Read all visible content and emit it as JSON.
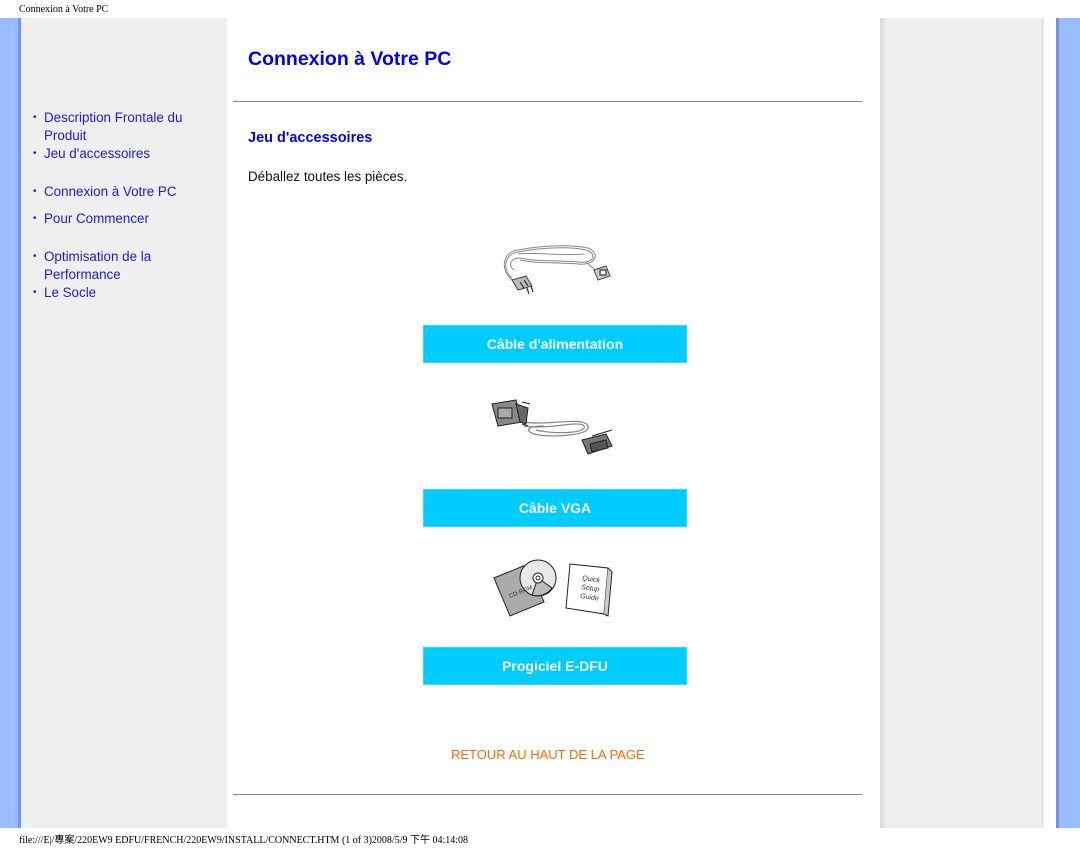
{
  "print_header": "Connexion à Votre PC",
  "print_footer": "file:///E|/專案/220EW9 EDFU/FRENCH/220EW9/INSTALL/CONNECT.HTM (1 of 3)2008/5/9 下午 04:14:08",
  "sidebar": {
    "bullet": "•",
    "items": [
      {
        "label": "Description Frontale du Produit"
      },
      {
        "label": "Jeu d'accessoires"
      },
      {
        "label": "Connexion à Votre PC"
      },
      {
        "label": "Pour Commencer"
      },
      {
        "label": "Optimisation de la Performance"
      },
      {
        "label": "Le Socle"
      }
    ]
  },
  "main": {
    "title": "Connexion à Votre PC",
    "section_title": "Jeu d'accessoires",
    "intro": "Déballez toutes les pièces.",
    "items": [
      {
        "icon": "power-cable-icon",
        "label": "Câble d'alimentation"
      },
      {
        "icon": "vga-cable-icon",
        "label": "Câble VGA"
      },
      {
        "icon": "cd-rom-guide-icon",
        "label": "Progiciel E-DFU",
        "cd_text": "CD-ROM",
        "guide_text": [
          "Quick",
          "Setup",
          "Guide"
        ]
      }
    ],
    "back_to_top": "RETOUR AU HAUT DE LA PAGE"
  },
  "colors": {
    "link": "#1a1aee",
    "heading": "#0000ff",
    "label_bg": "#00ccff",
    "back_link": "#ff6a00",
    "side_bar": "#99bbff",
    "panel_bg": "#efefef"
  }
}
